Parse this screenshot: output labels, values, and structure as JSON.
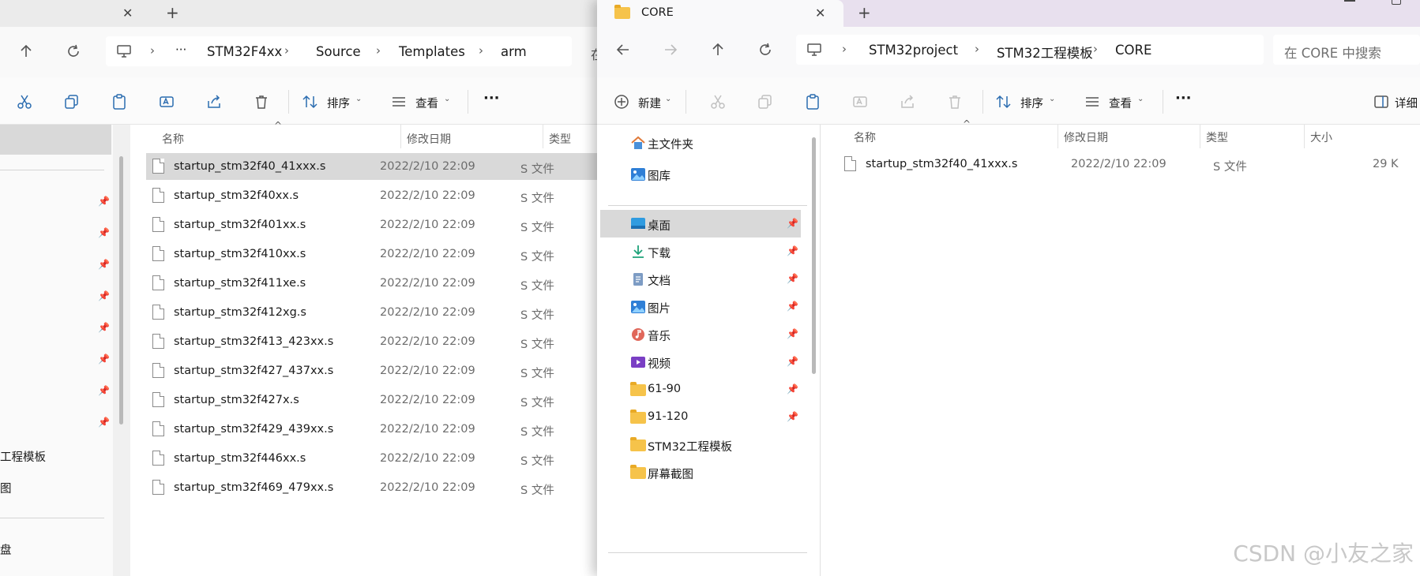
{
  "left_window": {
    "tab": {
      "close": "✕",
      "new": "+"
    },
    "breadcrumb": {
      "more": "···",
      "items": [
        "STM32F4xx",
        "Source",
        "Templates",
        "arm"
      ],
      "cut_char": "在"
    },
    "toolbar": {
      "sort": "排序",
      "view": "查看",
      "more": "···"
    },
    "columns": {
      "name": "名称",
      "date": "修改日期",
      "type": "类型"
    },
    "files": [
      {
        "name": "startup_stm32f40_41xxx.s",
        "date": "2022/2/10 22:09",
        "type": "S 文件"
      },
      {
        "name": "startup_stm32f40xx.s",
        "date": "2022/2/10 22:09",
        "type": "S 文件"
      },
      {
        "name": "startup_stm32f401xx.s",
        "date": "2022/2/10 22:09",
        "type": "S 文件"
      },
      {
        "name": "startup_stm32f410xx.s",
        "date": "2022/2/10 22:09",
        "type": "S 文件"
      },
      {
        "name": "startup_stm32f411xe.s",
        "date": "2022/2/10 22:09",
        "type": "S 文件"
      },
      {
        "name": "startup_stm32f412xg.s",
        "date": "2022/2/10 22:09",
        "type": "S 文件"
      },
      {
        "name": "startup_stm32f413_423xx.s",
        "date": "2022/2/10 22:09",
        "type": "S 文件"
      },
      {
        "name": "startup_stm32f427_437xx.s",
        "date": "2022/2/10 22:09",
        "type": "S 文件"
      },
      {
        "name": "startup_stm32f427x.s",
        "date": "2022/2/10 22:09",
        "type": "S 文件"
      },
      {
        "name": "startup_stm32f429_439xx.s",
        "date": "2022/2/10 22:09",
        "type": "S 文件"
      },
      {
        "name": "startup_stm32f446xx.s",
        "date": "2022/2/10 22:09",
        "type": "S 文件"
      },
      {
        "name": "startup_stm32f469_479xx.s",
        "date": "2022/2/10 22:09",
        "type": "S 文件"
      }
    ],
    "nav_fragments": [
      "工程模板",
      "图",
      "盘"
    ]
  },
  "right_window": {
    "tab": {
      "title": "CORE",
      "close": "✕",
      "new": "+"
    },
    "breadcrumb": {
      "items": [
        "STM32project",
        "STM32工程模板",
        "CORE"
      ]
    },
    "search": {
      "placeholder": "在 CORE 中搜索"
    },
    "toolbar": {
      "new": "新建",
      "sort": "排序",
      "view": "查看",
      "more": "···",
      "details": "详细"
    },
    "nav": {
      "top": [
        {
          "label": "主文件夹",
          "icon": "home-icon"
        },
        {
          "label": "图库",
          "icon": "gallery-icon"
        }
      ],
      "quick": [
        {
          "label": "桌面",
          "icon": "desktop-icon",
          "pinned": true,
          "selected": true
        },
        {
          "label": "下载",
          "icon": "download-icon",
          "pinned": true
        },
        {
          "label": "文档",
          "icon": "document-icon",
          "pinned": true
        },
        {
          "label": "图片",
          "icon": "pictures-icon",
          "pinned": true
        },
        {
          "label": "音乐",
          "icon": "music-icon",
          "pinned": true
        },
        {
          "label": "视频",
          "icon": "video-icon",
          "pinned": true
        },
        {
          "label": "61-90",
          "icon": "folder-icon",
          "pinned": true
        },
        {
          "label": "91-120",
          "icon": "folder-icon",
          "pinned": true
        },
        {
          "label": "STM32工程模板",
          "icon": "folder-icon",
          "pinned": false
        },
        {
          "label": "屏幕截图",
          "icon": "folder-icon",
          "pinned": false
        }
      ]
    },
    "columns": {
      "name": "名称",
      "date": "修改日期",
      "type": "类型",
      "size": "大小"
    },
    "files": [
      {
        "name": "startup_stm32f40_41xxx.s",
        "date": "2022/2/10 22:09",
        "type": "S 文件",
        "size": "29 K"
      }
    ]
  },
  "watermark": "CSDN @小友之家",
  "colors": {
    "accent": "#2b6cb0",
    "selected_row": "#d9d9d9",
    "right_tab_bg": "#e8e0ee"
  }
}
